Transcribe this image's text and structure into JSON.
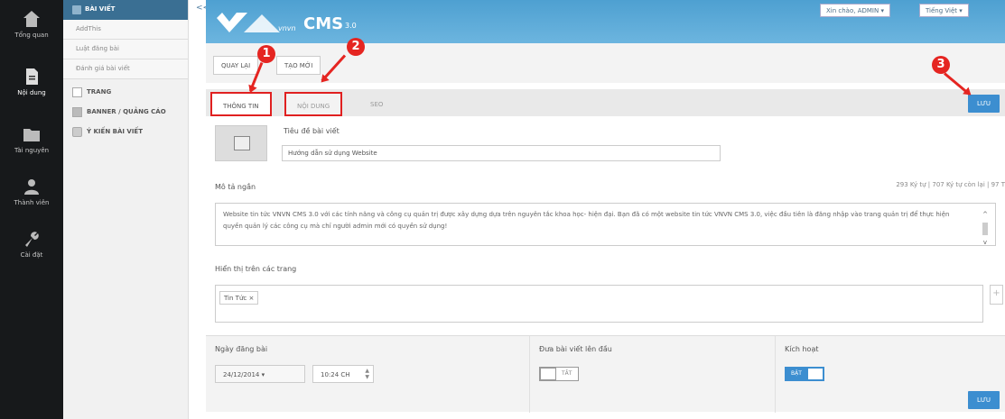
{
  "rail": [
    {
      "label": "Tổng quan",
      "icon": "home-icon"
    },
    {
      "label": "Nội dung",
      "icon": "document-icon"
    },
    {
      "label": "Tài nguyên",
      "icon": "folder-icon"
    },
    {
      "label": "Thành viên",
      "icon": "users-icon"
    },
    {
      "label": "Cài đặt",
      "icon": "wrench-icon"
    }
  ],
  "submenu": {
    "header": "BÀI VIẾT",
    "items": [
      "AddThis",
      "Luật đăng bài",
      "Đánh giá bài viết"
    ],
    "groups": [
      "TRANG",
      "BANNER / QUẢNG CÁO",
      "Ý KIẾN BÀI VIẾT"
    ]
  },
  "collapse": "<<",
  "header": {
    "logo_brand": "vnvn",
    "logo_name": "CMS",
    "logo_version": "3.0",
    "greeting": "Xin chào, ADMIN ▾",
    "language": "Tiếng Việt ▾"
  },
  "actions": {
    "back": "QUAY LẠI",
    "new": "TẠO MỚI"
  },
  "tabs": [
    "THÔNG TIN",
    "NỘI DUNG",
    "SEO"
  ],
  "save_label": "LƯU",
  "form": {
    "title_label": "Tiêu đề bài viết",
    "title_value": "Hướng dẫn sử dụng Website",
    "desc_label": "Mô tả ngắn",
    "counter": "293 Ký tự | 707 Ký tự còn lại | 97 T",
    "desc_value": "Website tin tức VNVN CMS 3.0 với các tính năng và công cụ quản trị được xây dựng dựa trên nguyên tắc khoa học- hiện đại. Bạn đã có một website tin tức VNVN CMS 3.0, việc đầu tiên là đăng nhập vào trang quản trị để thực hiện quyền quản lý các công cụ mà chỉ người admin mới có quyền sử dụng!",
    "pages_label": "Hiển thị trên các trang",
    "tag": "Tin Tức ×",
    "plus": "+",
    "date_label": "Ngày đăng bài",
    "date_value": "24/12/2014 ▾",
    "time_value": "10:24 CH",
    "pin_label": "Đưa bài viết lên đầu",
    "pin_state": "TẮT",
    "active_label": "Kích hoạt",
    "active_state": "BẬT"
  },
  "annotations": [
    "1",
    "2",
    "3"
  ],
  "colors": {
    "accent": "#3c8ed0",
    "highlight": "#e02020",
    "header": "#4ea0d1",
    "rail": "#17191b"
  }
}
